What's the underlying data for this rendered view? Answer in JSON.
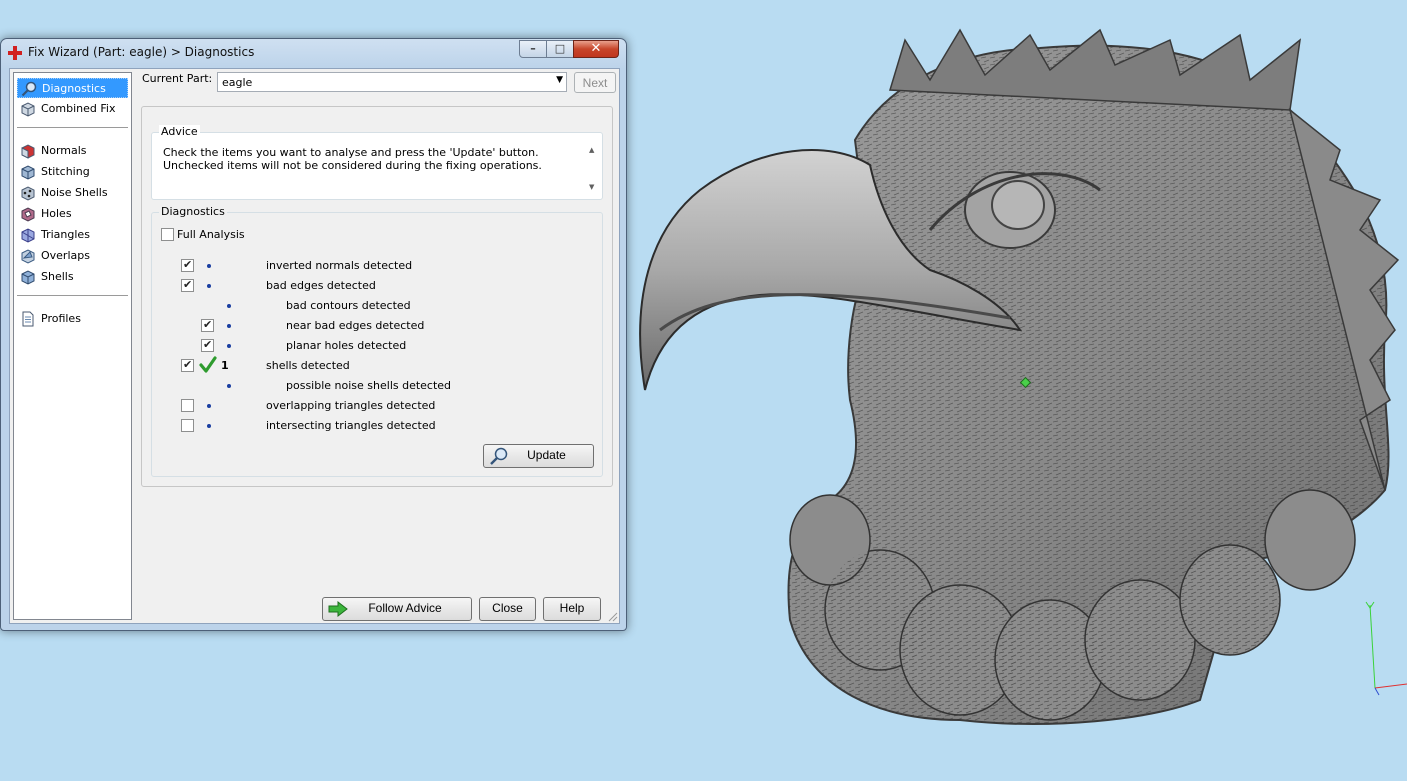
{
  "window": {
    "title": "Fix Wizard (Part: eagle) > Diagnostics",
    "controls": {
      "minimize": "–",
      "maximize": "□",
      "close": "✕"
    }
  },
  "nav": {
    "group1": [
      {
        "label": "Diagnostics",
        "icon": "magnifier-icon",
        "selected": true
      },
      {
        "label": "Combined Fix",
        "icon": "cube-icon"
      }
    ],
    "group2": [
      {
        "label": "Normals",
        "icon": "normals-cube-icon"
      },
      {
        "label": "Stitching",
        "icon": "stitching-icon"
      },
      {
        "label": "Noise Shells",
        "icon": "noise-shells-icon"
      },
      {
        "label": "Holes",
        "icon": "holes-icon"
      },
      {
        "label": "Triangles",
        "icon": "triangles-icon"
      },
      {
        "label": "Overlaps",
        "icon": "overlaps-icon"
      },
      {
        "label": "Shells",
        "icon": "shells-icon"
      }
    ],
    "group3": [
      {
        "label": "Profiles",
        "icon": "document-icon"
      }
    ]
  },
  "part": {
    "label": "Current Part:",
    "value": "eagle",
    "next_label": "Next"
  },
  "advice": {
    "title": "Advice",
    "text": "Check the items you want to analyse and press the 'Update' button. Unchecked items will not be considered during the fixing operations."
  },
  "diagnostics": {
    "title": "Diagnostics",
    "full_analysis_label": "Full Analysis",
    "full_analysis_checked": false,
    "rows": [
      {
        "label": "inverted normals detected",
        "checked": true,
        "level": 0,
        "has_checkbox": true,
        "count": "",
        "ok": false
      },
      {
        "label": "bad edges detected",
        "checked": true,
        "level": 0,
        "has_checkbox": true,
        "count": "",
        "ok": false
      },
      {
        "label": "bad contours detected",
        "checked": false,
        "level": 1,
        "has_checkbox": false,
        "count": "",
        "ok": false
      },
      {
        "label": "near bad edges detected",
        "checked": true,
        "level": 1,
        "has_checkbox": true,
        "count": "",
        "ok": false
      },
      {
        "label": "planar holes detected",
        "checked": true,
        "level": 1,
        "has_checkbox": true,
        "count": "",
        "ok": false
      },
      {
        "label": "shells detected",
        "checked": true,
        "level": 0,
        "has_checkbox": true,
        "count": "1",
        "ok": true
      },
      {
        "label": "possible noise shells detected",
        "checked": false,
        "level": 1,
        "has_checkbox": false,
        "count": "",
        "ok": false
      },
      {
        "label": "overlapping triangles detected",
        "checked": false,
        "level": 0,
        "has_checkbox": true,
        "count": "",
        "ok": false
      },
      {
        "label": "intersecting triangles detected",
        "checked": false,
        "level": 0,
        "has_checkbox": true,
        "count": "",
        "ok": false
      }
    ],
    "update_label": "Update"
  },
  "footer": {
    "follow_advice": "Follow Advice",
    "close": "Close",
    "help": "Help"
  },
  "colors": {
    "viewport_bg": "#b9dcf2",
    "selection": "#3399ff",
    "ok_green": "#2e9b2e"
  }
}
